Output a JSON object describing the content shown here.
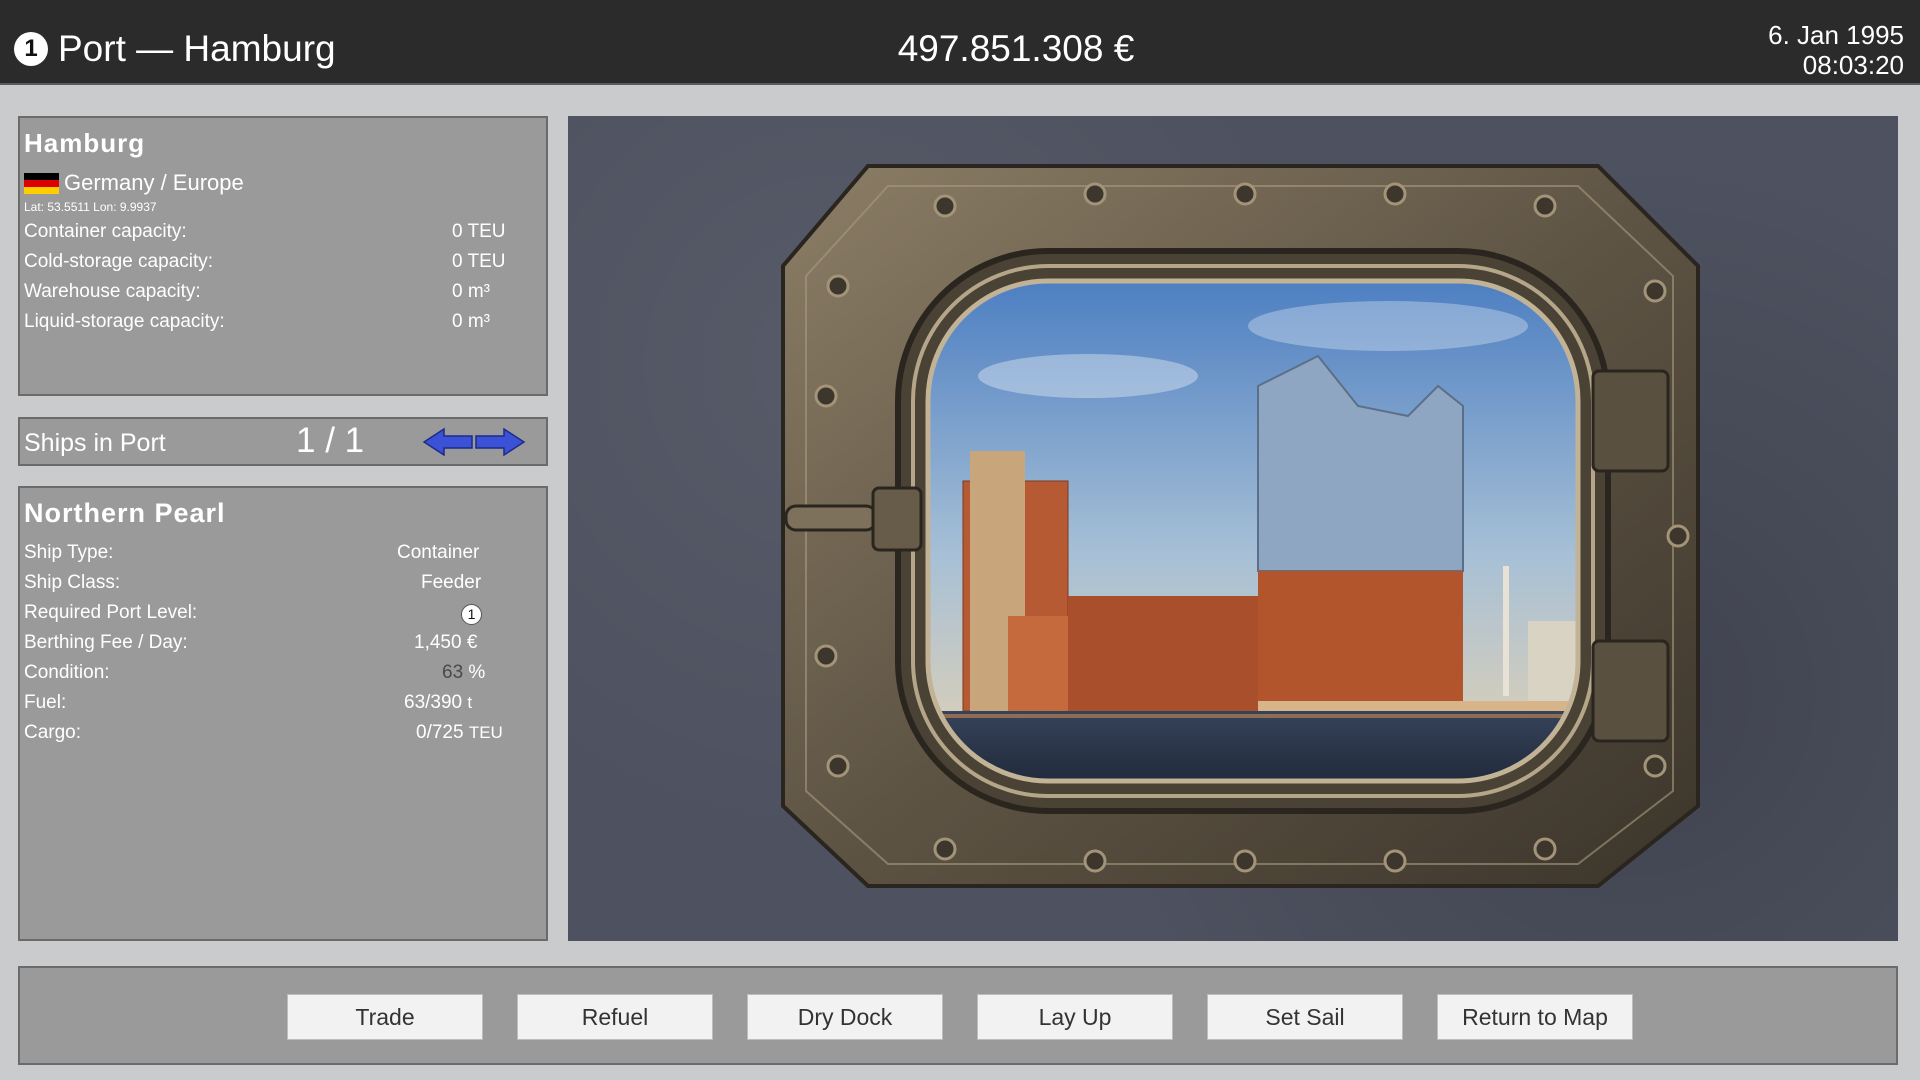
{
  "header": {
    "level": "1",
    "title": "Port — Hamburg",
    "money": "497.851.308 €",
    "date": "6. Jan 1995",
    "time": "08:03:20"
  },
  "port": {
    "name": "Hamburg",
    "country": "Germany / Europe",
    "flag_colors": [
      "#000000",
      "#dd0000",
      "#ffce00"
    ],
    "coords": "Lat: 53.5511 Lon: 9.9937",
    "capacities": [
      {
        "label": "Container capacity:",
        "value": "0 TEU"
      },
      {
        "label": "Cold-storage capacity:",
        "value": "0 TEU"
      },
      {
        "label": "Warehouse capacity:",
        "value": "0 m³"
      },
      {
        "label": "Liquid-storage capacity:",
        "value": "0 m³"
      }
    ]
  },
  "ships_in_port": {
    "label": "Ships in Port",
    "count": "1 / 1",
    "prev_icon": "arrow-left-icon",
    "next_icon": "arrow-right-icon",
    "arrow_color": "#3b52d6"
  },
  "ship": {
    "name": "Northern Pearl",
    "type_label": "Ship Type:",
    "type_value": "Container",
    "class_label": "Ship Class:",
    "class_value": "Feeder",
    "port_level_label": "Required Port Level:",
    "port_level_value": "1",
    "fee_label": "Berthing Fee / Day:",
    "fee_value": "1,450 €",
    "condition_label": "Condition:",
    "condition_value": "63",
    "condition_unit": "%",
    "fuel_label": "Fuel:",
    "fuel_value": "63/390",
    "fuel_unit": "t",
    "cargo_label": "Cargo:",
    "cargo_value": "0/725",
    "cargo_unit": "TEU"
  },
  "actions": {
    "trade": "Trade",
    "refuel": "Refuel",
    "dry_dock": "Dry Dock",
    "lay_up": "Lay Up",
    "set_sail": "Set Sail",
    "return_to_map": "Return to Map"
  }
}
